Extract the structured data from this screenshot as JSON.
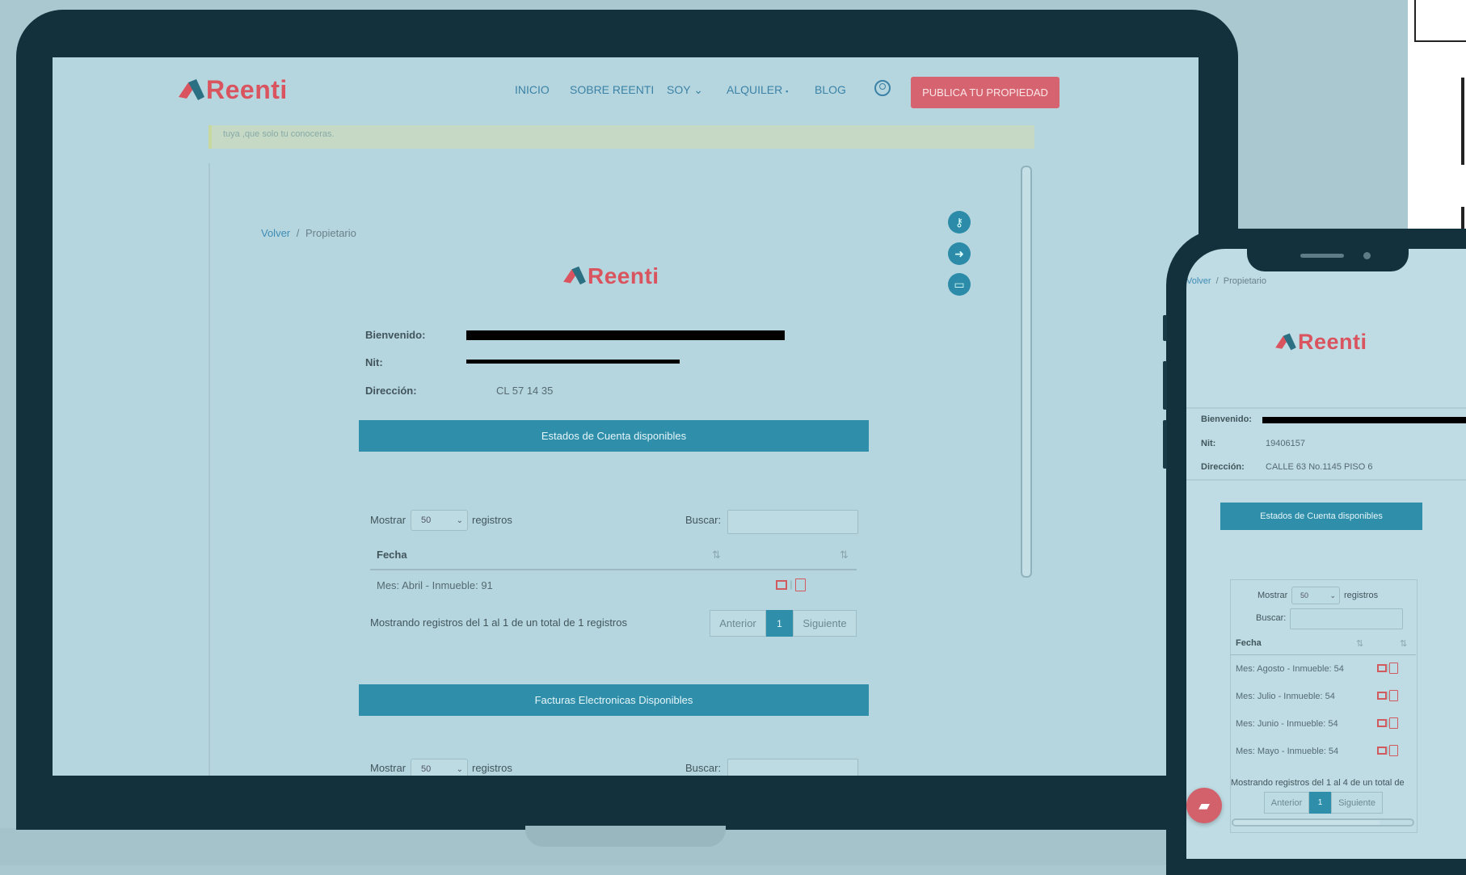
{
  "laptop": {
    "brand": "Reenti",
    "nav": [
      "INICIO",
      "SOBRE REENTI",
      "SOY",
      "ALQUILER",
      "BLOG"
    ],
    "publish_button": "PUBLICA TU PROPIEDAD",
    "alert_text": "tuya ,que solo tu conoceras.",
    "breadcrumb": {
      "back": "Volver",
      "sep": "/",
      "current": "Propietario"
    },
    "panel_logo": "Reenti",
    "info": {
      "bienvenido_label": "Bienvenido:",
      "nit_label": "Nit:",
      "direccion_label": "Dirección:",
      "direccion_value": "CL 57 14 35"
    },
    "section1": {
      "title": "Estados de Cuenta disponibles",
      "show_label": "Mostrar",
      "show_value": "50",
      "records_label": "registros",
      "search_label": "Buscar:",
      "col_fecha": "Fecha",
      "rows": [
        "Mes: Abril - Inmueble: 91"
      ],
      "summary": "Mostrando registros del 1 al 1 de un total de 1 registros",
      "prev": "Anterior",
      "page": "1",
      "next": "Siguiente"
    },
    "section2": {
      "title": "Facturas Electronicas Disponibles",
      "show_label": "Mostrar",
      "show_value": "50",
      "records_label": "registros",
      "search_label": "Buscar:"
    }
  },
  "phone": {
    "breadcrumb": {
      "back": "Volver",
      "sep": "/",
      "current": "Propietario"
    },
    "logo": "Reenti",
    "info": {
      "bienvenido_label": "Bienvenido:",
      "nit_label": "Nit:",
      "nit_value": "19406157",
      "direccion_label": "Dirección:",
      "direccion_value": "CALLE 63 No.1145 PISO 6"
    },
    "section_title": "Estados de Cuenta disponibles",
    "show_label": "Mostrar",
    "show_value": "50",
    "records_label": "registros",
    "search_label": "Buscar:",
    "col_fecha": "Fecha",
    "rows": [
      "Mes: Agosto - Inmueble: 54",
      "Mes: Julio - Inmueble: 54",
      "Mes: Junio - Inmueble: 54",
      "Mes: Mayo - Inmueble: 54"
    ],
    "summary": "Mostrando registros del 1 al 4 de un total de",
    "prev": "Anterior",
    "page": "1",
    "next": "Siguiente"
  },
  "colors": {
    "brand": "#d9545f",
    "accent": "#2f8ea9",
    "device": "#12313c"
  }
}
